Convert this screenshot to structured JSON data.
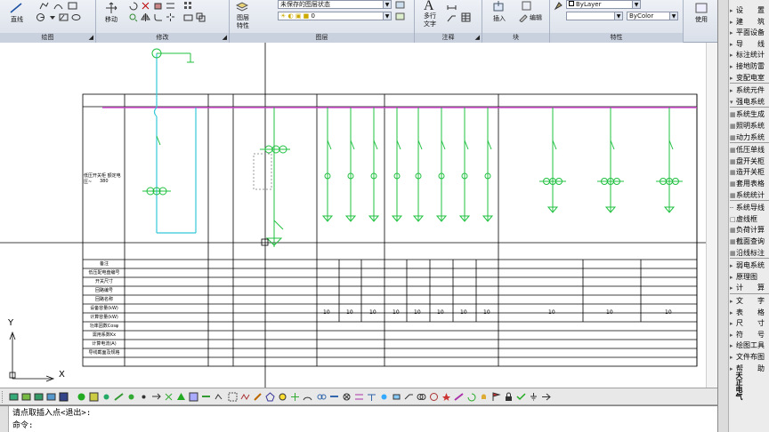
{
  "ribbon": {
    "draw_panel": {
      "title": "绘图",
      "line_label": "直线"
    },
    "modify_panel": {
      "title": "修改",
      "move_label": "移动"
    },
    "layers_panel": {
      "title": "图层",
      "props_label": "图层\n特性",
      "state_combo": "未保存的图层状态",
      "layer_combo": "0"
    },
    "annotate_panel": {
      "title": "注释",
      "text_label": "多行\n文字"
    },
    "block_panel": {
      "title": "块",
      "insert_label": "插入",
      "edit_label": "编辑"
    },
    "props_panel": {
      "title": "特性",
      "color_combo": "ByLayer",
      "lineweight_combo": "ByColor"
    },
    "utils_label": "使用"
  },
  "drawing": {
    "labels": {
      "main_left": "低压开关柜 额定电压~",
      "main_left_value": "380",
      "rows": [
        "备注",
        "低压配电盘编号",
        "开关尺寸",
        "回路编号",
        "回路名称",
        "设备容量(kW)",
        "计算容量(kW)",
        "功率因数Cosφ",
        "需用系数Kx",
        "计算电流(A)",
        "导线截面及规格"
      ]
    },
    "capacity_values": [
      "10",
      "10",
      "10",
      "10",
      "10",
      "10",
      "10",
      "10",
      "10",
      "10",
      "10"
    ]
  },
  "ucs": {
    "y_label": "Y",
    "x_label": "X"
  },
  "command": {
    "history": "请点取插入点<退出>:",
    "prompt": "命令:"
  },
  "side_menu": {
    "items": [
      {
        "icon": "▸",
        "label": "设　　置"
      },
      {
        "icon": "▸",
        "label": "建　　筑"
      },
      {
        "icon": "▸",
        "label": "平面设备"
      },
      {
        "icon": "▸",
        "label": "导　　线"
      },
      {
        "icon": "▸",
        "label": "标注统计"
      },
      {
        "icon": "▸",
        "label": "接地防雷"
      },
      {
        "icon": "▸",
        "label": "变配电室"
      },
      {
        "icon": "▸",
        "label": "系统元件"
      },
      {
        "icon": "▾",
        "label": "强电系统"
      },
      {
        "icon": "▦",
        "label": "系统生成"
      },
      {
        "icon": "▦",
        "label": "照明系统"
      },
      {
        "icon": "▦",
        "label": "动力系统"
      },
      {
        "icon": "▦",
        "label": "低压单线"
      },
      {
        "icon": "▦",
        "label": "盘开关柜"
      },
      {
        "icon": "▦",
        "label": "造开关柜"
      },
      {
        "icon": "▦",
        "label": "套用表格"
      },
      {
        "icon": "▦",
        "label": "系统统计"
      },
      {
        "icon": "┄",
        "label": "系统导线"
      },
      {
        "icon": "□",
        "label": "虚线框"
      },
      {
        "icon": "▦",
        "label": "负荷计算"
      },
      {
        "icon": "▦",
        "label": "截面查询"
      },
      {
        "icon": "▦",
        "label": "沿线标注"
      },
      {
        "icon": "▸",
        "label": "弱电系统"
      },
      {
        "icon": "▸",
        "label": "原理图"
      },
      {
        "icon": "▸",
        "label": "计　　算"
      },
      {
        "icon": "▸",
        "label": "文　　字"
      },
      {
        "icon": "▸",
        "label": "表　　格"
      },
      {
        "icon": "▸",
        "label": "尺　　寸"
      },
      {
        "icon": "▸",
        "label": "符　　号"
      },
      {
        "icon": "▸",
        "label": "绘图工具"
      },
      {
        "icon": "▸",
        "label": "文件布图"
      },
      {
        "icon": "▸",
        "label": "帮　　助"
      }
    ],
    "vertical_title": "天正电气"
  }
}
